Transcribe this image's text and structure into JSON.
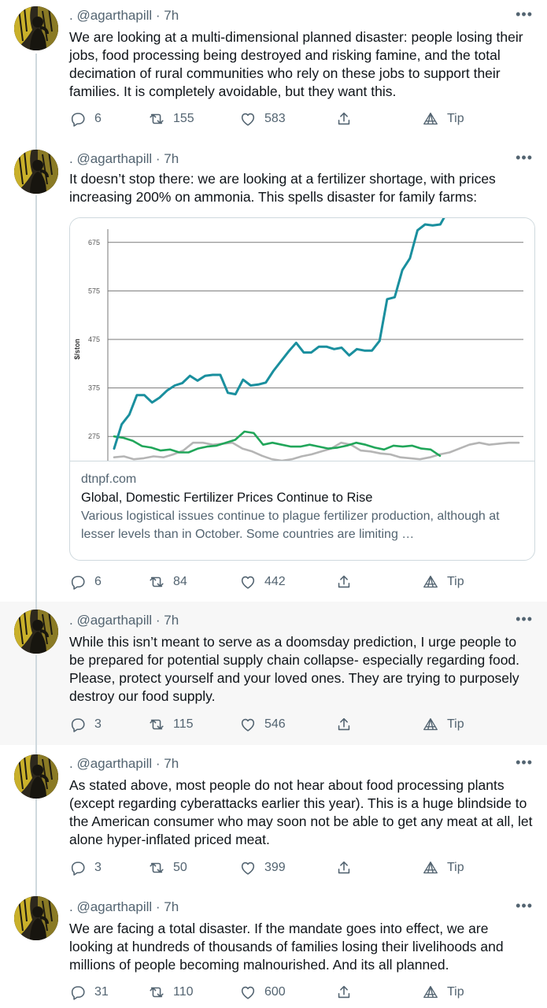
{
  "tweets": [
    {
      "handle": ". @agarthapill",
      "time": "7h",
      "text": "We are looking at a multi-dimensional planned disaster: people losing their jobs, food processing being destroyed and risking famine, and the total decimation of rural communities who rely on these jobs to support their families. It is completely avoidable, but they want this.",
      "replies": "6",
      "retweets": "155",
      "likes": "583",
      "tip": "Tip"
    },
    {
      "handle": ". @agarthapill",
      "time": "7h",
      "text": "It doesn’t stop there: we are looking at a fertilizer shortage, with prices increasing 200% on ammonia. This spells disaster for family farms:",
      "replies": "6",
      "retweets": "84",
      "likes": "442",
      "tip": "Tip"
    },
    {
      "handle": ". @agarthapill",
      "time": "7h",
      "text": "While this isn’t meant to serve as a doomsday prediction, I urge people to be prepared for potential supply chain collapse- especially regarding food. Please, protect yourself and your loved ones. They are trying to purposely destroy our food supply.",
      "replies": "3",
      "retweets": "115",
      "likes": "546",
      "tip": "Tip"
    },
    {
      "handle": ". @agarthapill",
      "time": "7h",
      "text": "As stated above, most people do not hear about food processing plants (except regarding cyberattacks earlier this year). This is a huge blindside to the American consumer who may soon not be able to get any meat at all, let alone hyper-inflated priced meat.",
      "replies": "3",
      "retweets": "50",
      "likes": "399",
      "tip": "Tip"
    },
    {
      "handle": ". @agarthapill",
      "time": "7h",
      "text": "We are facing a total disaster. If the mandate goes into effect, we are looking at hundreds of thousands of families losing their livelihoods and millions of people becoming malnourished. And its all planned.",
      "replies": "31",
      "retweets": "110",
      "likes": "600",
      "tip": "Tip"
    }
  ],
  "card": {
    "domain": "dtnpf.com",
    "title": "Global, Domestic Fertilizer Prices Continue to Rise",
    "description": "Various logistical issues continue to plague fertilizer production, although at lesser levels than in October. Some countries are limiting …"
  },
  "icons": {
    "reply": "reply-icon",
    "retweet": "retweet-icon",
    "like": "heart-icon",
    "share": "share-icon",
    "tip": "tip-icon",
    "more": "more-icon"
  },
  "colors": {
    "teal_series": "#1a8f9e",
    "green_series": "#21a65a",
    "gray_series": "#b5b5b5",
    "text_secondary": "#536471"
  },
  "chart_data": {
    "type": "line",
    "title": "",
    "xlabel": "",
    "ylabel": "$/ston",
    "yticks": [
      275,
      375,
      475,
      575,
      675
    ],
    "ylim": [
      225,
      725
    ],
    "grid": true,
    "series": [
      {
        "values": [
          250,
          300,
          320,
          360,
          360,
          345,
          355,
          370,
          380,
          385,
          400,
          390,
          400,
          402,
          402,
          365,
          362,
          392,
          380,
          382,
          386,
          410,
          430,
          450,
          468,
          448,
          448,
          460,
          460,
          455,
          458,
          442,
          455,
          452,
          452,
          472,
          558,
          562,
          618,
          642,
          700,
          712,
          710,
          712,
          740
        ]
      },
      {
        "values": [
          275,
          272,
          266,
          255,
          252,
          246,
          248,
          242,
          242,
          250,
          254,
          256,
          262,
          268,
          285,
          282,
          258,
          262,
          258,
          254,
          254,
          258,
          254,
          250,
          252,
          256,
          262,
          258,
          252,
          248,
          256,
          254,
          256,
          250,
          248,
          235
        ]
      },
      {
        "values": [
          232,
          234,
          228,
          230,
          234,
          232,
          238,
          246,
          262,
          262,
          258,
          260,
          262,
          250,
          244,
          235,
          228,
          225,
          228,
          234,
          238,
          244,
          250,
          262,
          258,
          246,
          244,
          240,
          238,
          232,
          230,
          228,
          232,
          238,
          242,
          250,
          258,
          262,
          258,
          260,
          262,
          262
        ]
      }
    ]
  }
}
